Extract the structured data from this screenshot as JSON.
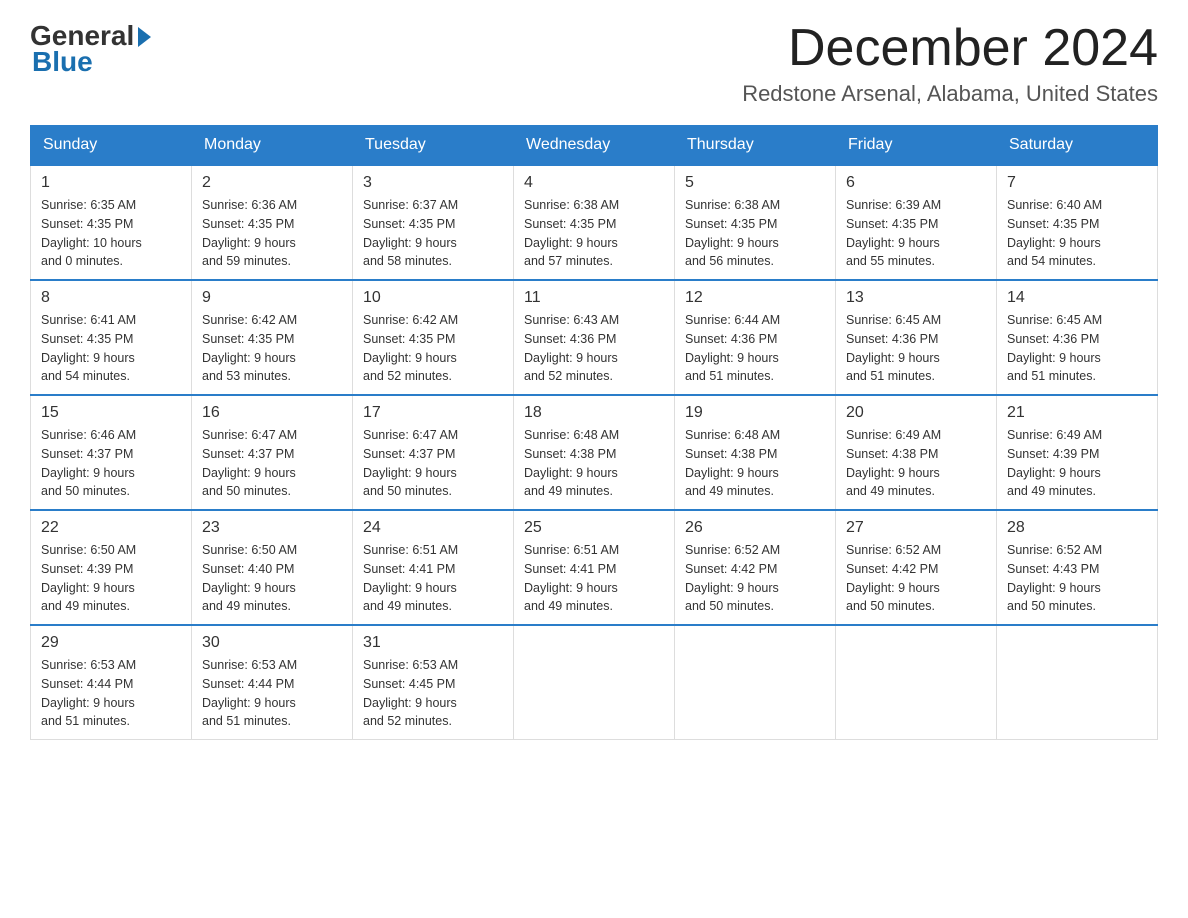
{
  "logo": {
    "line1": "General",
    "line2": "Blue"
  },
  "header": {
    "month_year": "December 2024",
    "location": "Redstone Arsenal, Alabama, United States"
  },
  "weekdays": [
    "Sunday",
    "Monday",
    "Tuesday",
    "Wednesday",
    "Thursday",
    "Friday",
    "Saturday"
  ],
  "weeks": [
    [
      {
        "day": "1",
        "sunrise": "6:35 AM",
        "sunset": "4:35 PM",
        "daylight": "10 hours and 0 minutes."
      },
      {
        "day": "2",
        "sunrise": "6:36 AM",
        "sunset": "4:35 PM",
        "daylight": "9 hours and 59 minutes."
      },
      {
        "day": "3",
        "sunrise": "6:37 AM",
        "sunset": "4:35 PM",
        "daylight": "9 hours and 58 minutes."
      },
      {
        "day": "4",
        "sunrise": "6:38 AM",
        "sunset": "4:35 PM",
        "daylight": "9 hours and 57 minutes."
      },
      {
        "day": "5",
        "sunrise": "6:38 AM",
        "sunset": "4:35 PM",
        "daylight": "9 hours and 56 minutes."
      },
      {
        "day": "6",
        "sunrise": "6:39 AM",
        "sunset": "4:35 PM",
        "daylight": "9 hours and 55 minutes."
      },
      {
        "day": "7",
        "sunrise": "6:40 AM",
        "sunset": "4:35 PM",
        "daylight": "9 hours and 54 minutes."
      }
    ],
    [
      {
        "day": "8",
        "sunrise": "6:41 AM",
        "sunset": "4:35 PM",
        "daylight": "9 hours and 54 minutes."
      },
      {
        "day": "9",
        "sunrise": "6:42 AM",
        "sunset": "4:35 PM",
        "daylight": "9 hours and 53 minutes."
      },
      {
        "day": "10",
        "sunrise": "6:42 AM",
        "sunset": "4:35 PM",
        "daylight": "9 hours and 52 minutes."
      },
      {
        "day": "11",
        "sunrise": "6:43 AM",
        "sunset": "4:36 PM",
        "daylight": "9 hours and 52 minutes."
      },
      {
        "day": "12",
        "sunrise": "6:44 AM",
        "sunset": "4:36 PM",
        "daylight": "9 hours and 51 minutes."
      },
      {
        "day": "13",
        "sunrise": "6:45 AM",
        "sunset": "4:36 PM",
        "daylight": "9 hours and 51 minutes."
      },
      {
        "day": "14",
        "sunrise": "6:45 AM",
        "sunset": "4:36 PM",
        "daylight": "9 hours and 51 minutes."
      }
    ],
    [
      {
        "day": "15",
        "sunrise": "6:46 AM",
        "sunset": "4:37 PM",
        "daylight": "9 hours and 50 minutes."
      },
      {
        "day": "16",
        "sunrise": "6:47 AM",
        "sunset": "4:37 PM",
        "daylight": "9 hours and 50 minutes."
      },
      {
        "day": "17",
        "sunrise": "6:47 AM",
        "sunset": "4:37 PM",
        "daylight": "9 hours and 50 minutes."
      },
      {
        "day": "18",
        "sunrise": "6:48 AM",
        "sunset": "4:38 PM",
        "daylight": "9 hours and 49 minutes."
      },
      {
        "day": "19",
        "sunrise": "6:48 AM",
        "sunset": "4:38 PM",
        "daylight": "9 hours and 49 minutes."
      },
      {
        "day": "20",
        "sunrise": "6:49 AM",
        "sunset": "4:38 PM",
        "daylight": "9 hours and 49 minutes."
      },
      {
        "day": "21",
        "sunrise": "6:49 AM",
        "sunset": "4:39 PM",
        "daylight": "9 hours and 49 minutes."
      }
    ],
    [
      {
        "day": "22",
        "sunrise": "6:50 AM",
        "sunset": "4:39 PM",
        "daylight": "9 hours and 49 minutes."
      },
      {
        "day": "23",
        "sunrise": "6:50 AM",
        "sunset": "4:40 PM",
        "daylight": "9 hours and 49 minutes."
      },
      {
        "day": "24",
        "sunrise": "6:51 AM",
        "sunset": "4:41 PM",
        "daylight": "9 hours and 49 minutes."
      },
      {
        "day": "25",
        "sunrise": "6:51 AM",
        "sunset": "4:41 PM",
        "daylight": "9 hours and 49 minutes."
      },
      {
        "day": "26",
        "sunrise": "6:52 AM",
        "sunset": "4:42 PM",
        "daylight": "9 hours and 50 minutes."
      },
      {
        "day": "27",
        "sunrise": "6:52 AM",
        "sunset": "4:42 PM",
        "daylight": "9 hours and 50 minutes."
      },
      {
        "day": "28",
        "sunrise": "6:52 AM",
        "sunset": "4:43 PM",
        "daylight": "9 hours and 50 minutes."
      }
    ],
    [
      {
        "day": "29",
        "sunrise": "6:53 AM",
        "sunset": "4:44 PM",
        "daylight": "9 hours and 51 minutes."
      },
      {
        "day": "30",
        "sunrise": "6:53 AM",
        "sunset": "4:44 PM",
        "daylight": "9 hours and 51 minutes."
      },
      {
        "day": "31",
        "sunrise": "6:53 AM",
        "sunset": "4:45 PM",
        "daylight": "9 hours and 52 minutes."
      },
      null,
      null,
      null,
      null
    ]
  ],
  "labels": {
    "sunrise": "Sunrise:",
    "sunset": "Sunset:",
    "daylight": "Daylight:"
  }
}
